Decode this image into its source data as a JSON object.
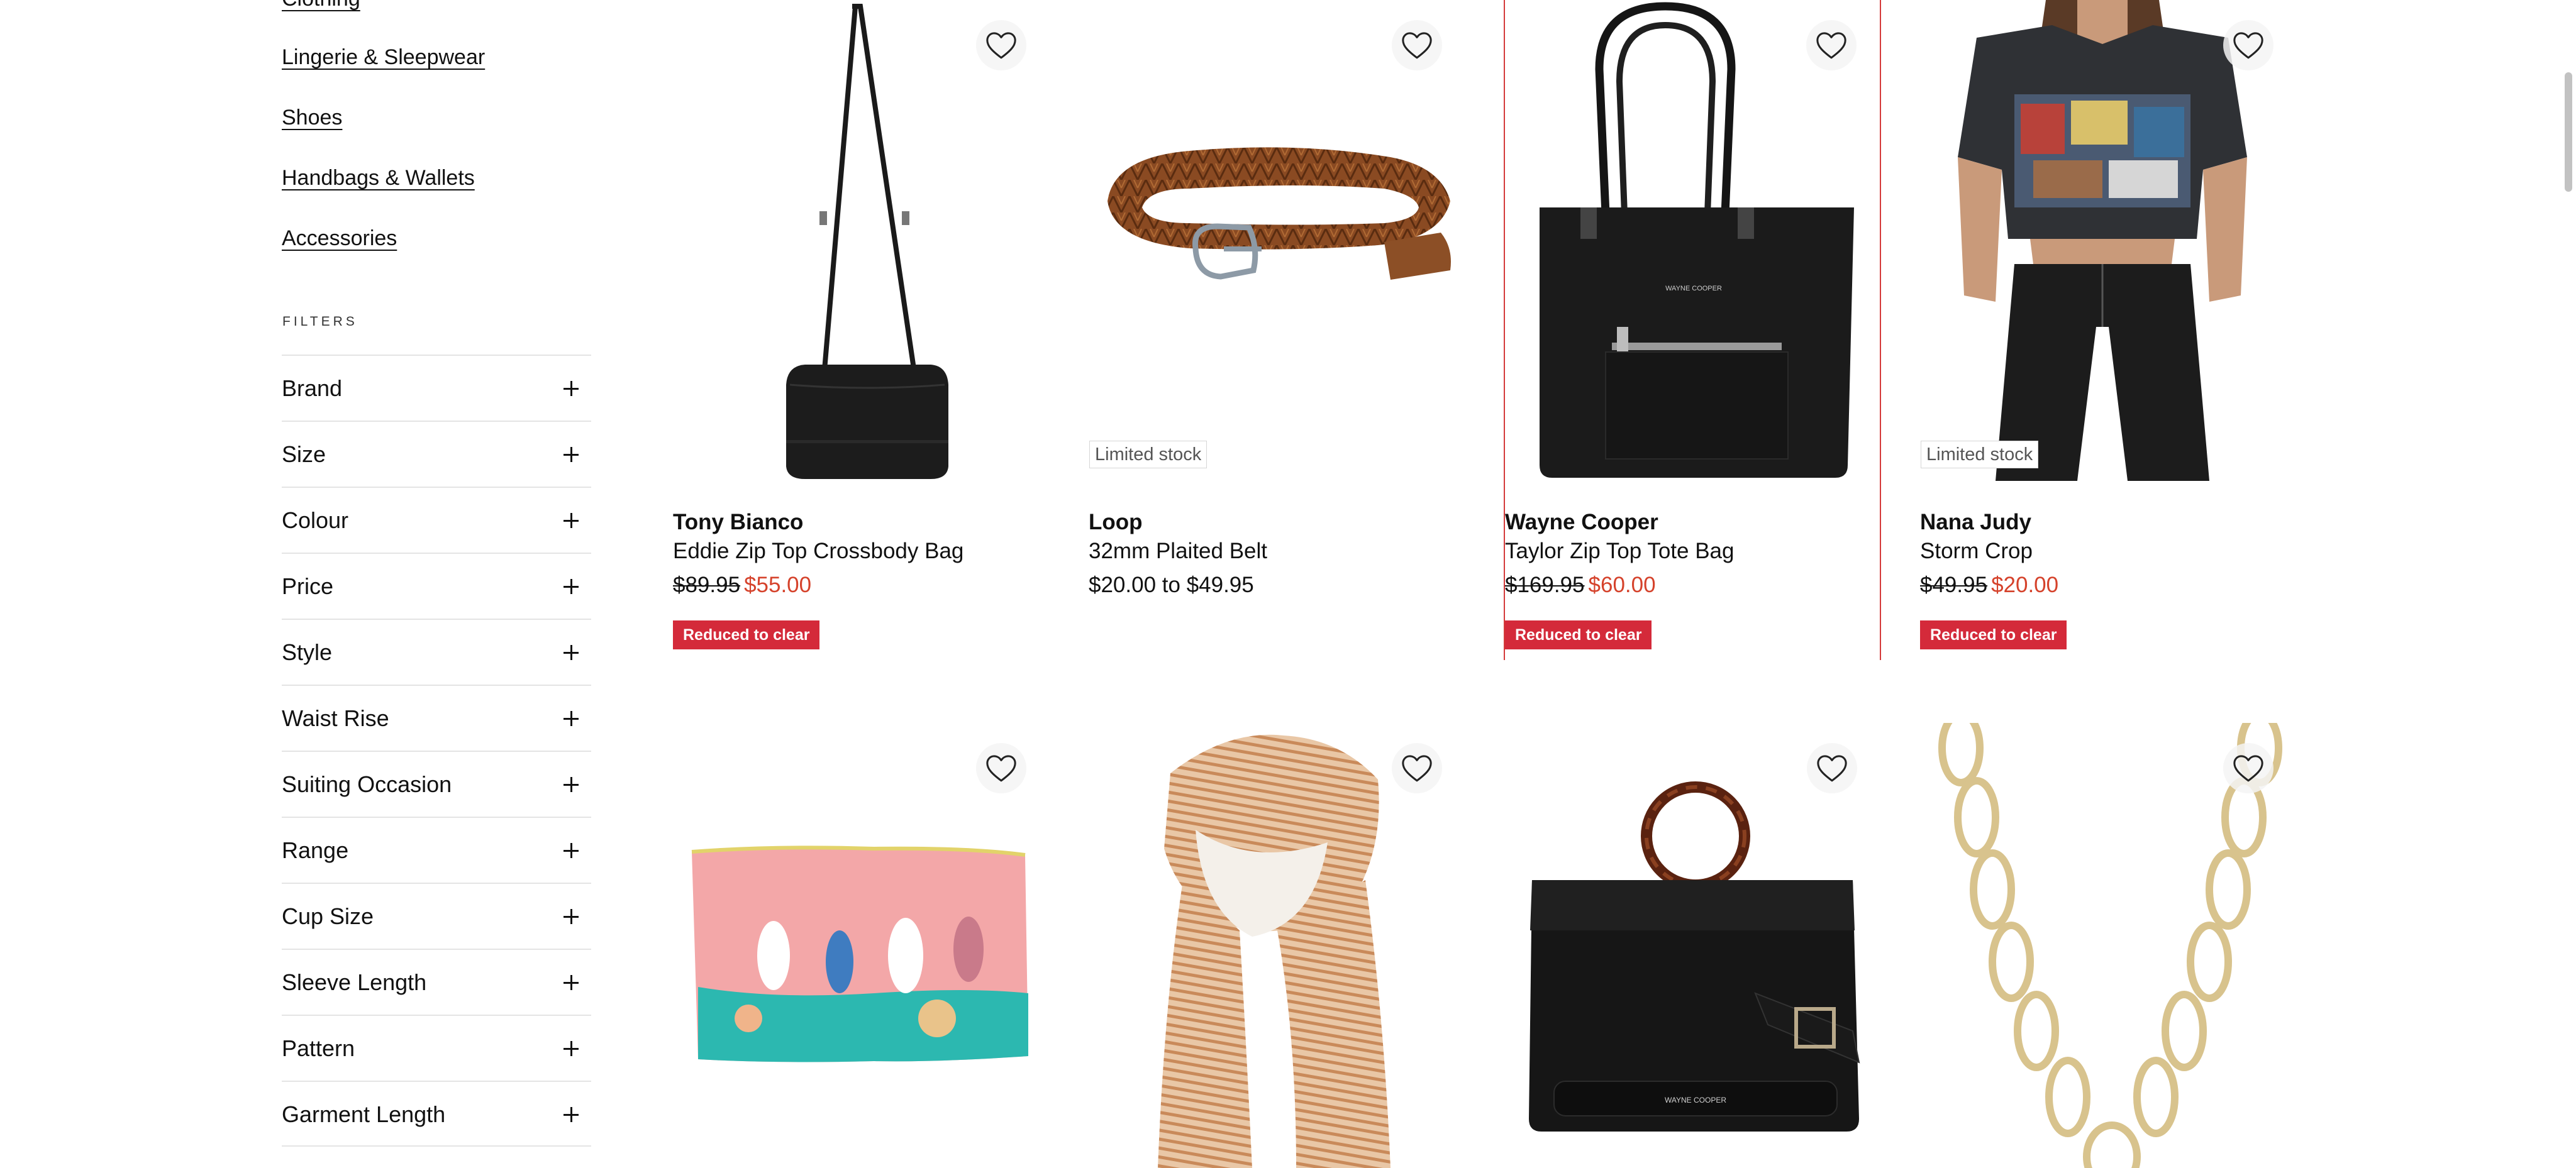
{
  "categories": [
    {
      "label": "Clothing"
    },
    {
      "label": "Lingerie & Sleepwear"
    },
    {
      "label": "Shoes"
    },
    {
      "label": "Handbags & Wallets"
    },
    {
      "label": "Accessories"
    }
  ],
  "filters": {
    "heading": "FILTERS",
    "items": [
      {
        "label": "Brand"
      },
      {
        "label": "Size"
      },
      {
        "label": "Colour"
      },
      {
        "label": "Price"
      },
      {
        "label": "Style"
      },
      {
        "label": "Waist Rise"
      },
      {
        "label": "Suiting Occasion"
      },
      {
        "label": "Range"
      },
      {
        "label": "Cup Size"
      },
      {
        "label": "Sleeve Length"
      },
      {
        "label": "Pattern"
      },
      {
        "label": "Garment Length"
      }
    ]
  },
  "products": [
    {
      "brand": "Tony Bianco",
      "name": "Eddie Zip Top Crossbody Bag",
      "was_price": "$89.95",
      "now_price": "$55.00",
      "badge": "Reduced to clear",
      "image": "black crossbody bag"
    },
    {
      "brand": "Loop",
      "name": "32mm Plaited Belt",
      "price_range": "$20.00 to $49.95",
      "stock": "Limited stock",
      "image": "tan plaited leather belt"
    },
    {
      "brand": "Wayne Cooper",
      "name": "Taylor Zip Top Tote Bag",
      "was_price": "$169.95",
      "now_price": "$60.00",
      "badge": "Reduced to clear",
      "image": "black tote bag"
    },
    {
      "brand": "Nana Judy",
      "name": "Storm Crop",
      "was_price": "$49.95",
      "now_price": "$20.00",
      "badge": "Reduced to clear",
      "stock": "Limited stock",
      "image": "model in graphic crop tee and leather pants"
    },
    {
      "image": "pink cockatoo print cosmetic pouch"
    },
    {
      "image": "striped neutral scarf"
    },
    {
      "image": "black woven handbag with tortoiseshell handle"
    },
    {
      "image": "gold oval link chain necklace"
    }
  ],
  "colors": {
    "sale_price": "#d5422b",
    "reduced_badge": "#d42a3a",
    "highlight_border": "#d43a3a"
  },
  "icons": {
    "favourite": "heart-outline-icon",
    "filter_expand": "plus-icon"
  }
}
